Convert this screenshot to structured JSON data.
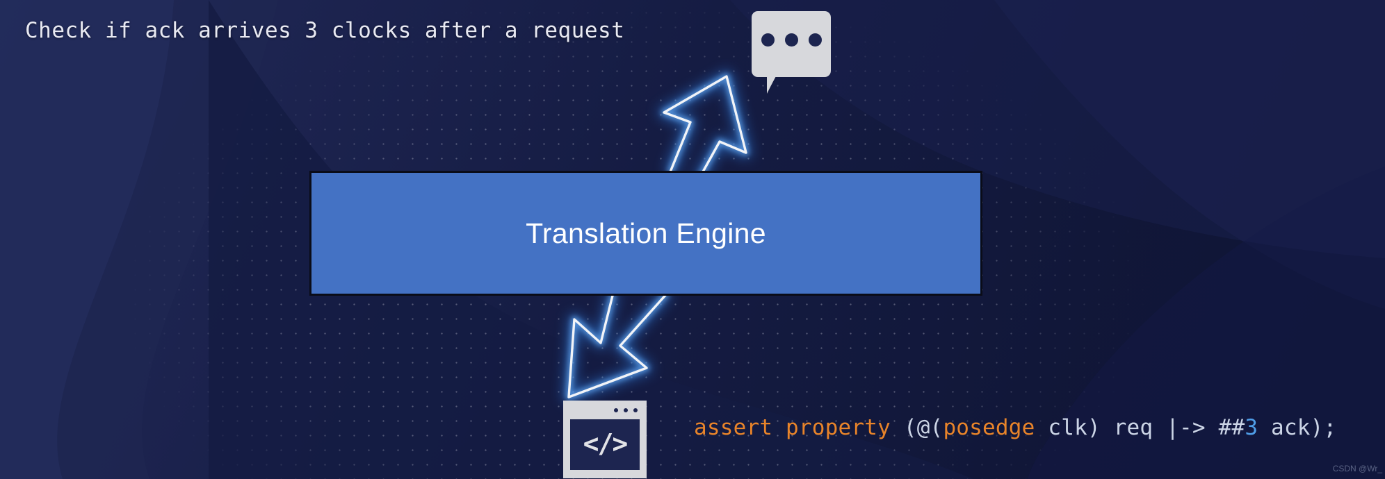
{
  "slide": {
    "prompt_text": "Check if ack arrives 3 clocks after a request",
    "engine_label": "Translation Engine",
    "watermark": "CSDN @Wr_"
  },
  "icons": {
    "speech_bubble": "speech-bubble-icon",
    "code_window": "code-window-icon",
    "code_glyph": "</>",
    "arrow_up": "arrow-up-right-icon",
    "arrow_down": "arrow-down-left-icon"
  },
  "code": {
    "tokens": [
      {
        "text": "assert property",
        "kind": "keyword"
      },
      {
        "text": " (@(",
        "kind": "plain"
      },
      {
        "text": "posedge",
        "kind": "keyword"
      },
      {
        "text": " clk) req |-> ##",
        "kind": "plain"
      },
      {
        "text": "3",
        "kind": "number"
      },
      {
        "text": " ack);",
        "kind": "plain"
      }
    ],
    "full_line": "assert property (@(posedge clk) req |-> ##3 ack);"
  },
  "colors": {
    "background_dark": "#161d47",
    "background_deep": "#0f1433",
    "engine_box_fill": "#4472C4",
    "engine_box_border": "#0a0c18",
    "icon_light": "#d7d8dc",
    "prompt_text": "#e8e9f2",
    "code_keyword": "#e8842a",
    "code_plain": "#ccd5e6",
    "code_number": "#4f9ee8",
    "arrow_stroke": "#f2f4f8",
    "arrow_glow": "#2f7fe0"
  }
}
